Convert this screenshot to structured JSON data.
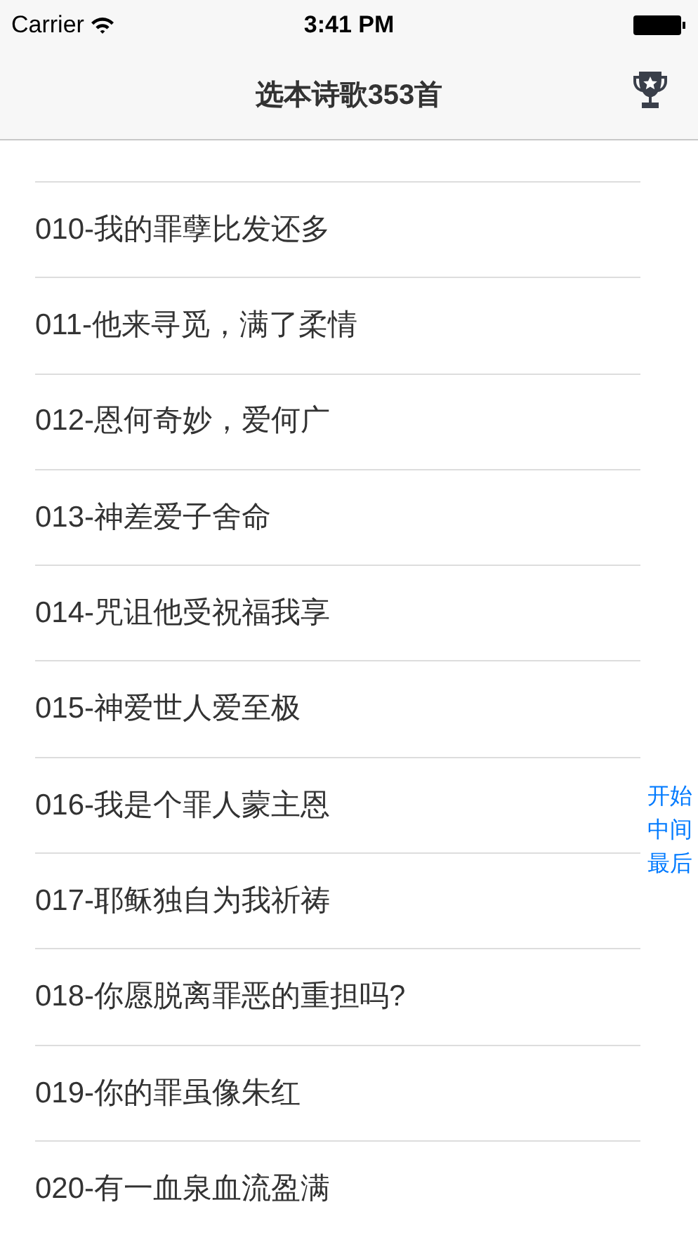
{
  "status_bar": {
    "carrier": "Carrier",
    "time": "3:41 PM"
  },
  "nav_bar": {
    "title": "选本诗歌353首"
  },
  "songs": [
    {
      "title": "010-我的罪孽比发还多"
    },
    {
      "title": "011-他来寻觅，满了柔情"
    },
    {
      "title": "012-恩何奇妙，爱何广"
    },
    {
      "title": "013-神差爱子舍命"
    },
    {
      "title": "014-咒诅他受祝福我享"
    },
    {
      "title": "015-神爱世人爱至极"
    },
    {
      "title": "016-我是个罪人蒙主恩"
    },
    {
      "title": "017-耶稣独自为我祈祷"
    },
    {
      "title": "018-你愿脱离罪恶的重担吗?"
    },
    {
      "title": "019-你的罪虽像朱红"
    },
    {
      "title": "020-有一血泉血流盈满"
    }
  ],
  "section_index": [
    "开始",
    "中间",
    "最后"
  ]
}
